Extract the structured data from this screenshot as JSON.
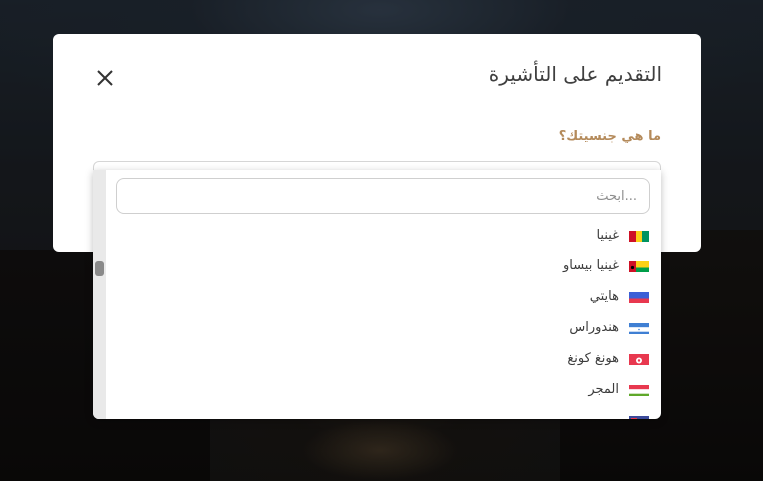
{
  "modal": {
    "title": "التقديم على التأشيرة",
    "close_label": "×"
  },
  "form": {
    "nationality_label": "ما هي جنسيتك؟"
  },
  "dropdown": {
    "search_placeholder": "...ابحث",
    "search_value": "",
    "options": [
      {
        "label": "غينيا",
        "flag": "guinea-flag"
      },
      {
        "label": "غينيا بيساو",
        "flag": "guinea-bissau-flag"
      },
      {
        "label": "هايتي",
        "flag": "haiti-flag"
      },
      {
        "label": "هندوراس",
        "flag": "honduras-flag"
      },
      {
        "label": "هونغ كونغ",
        "flag": "hong-kong-flag"
      },
      {
        "label": "المجر",
        "flag": "hungary-flag"
      }
    ]
  },
  "colors": {
    "label_accent": "#b48a5a",
    "title_text": "#3f3f3f",
    "option_text": "#3c3c3c"
  }
}
